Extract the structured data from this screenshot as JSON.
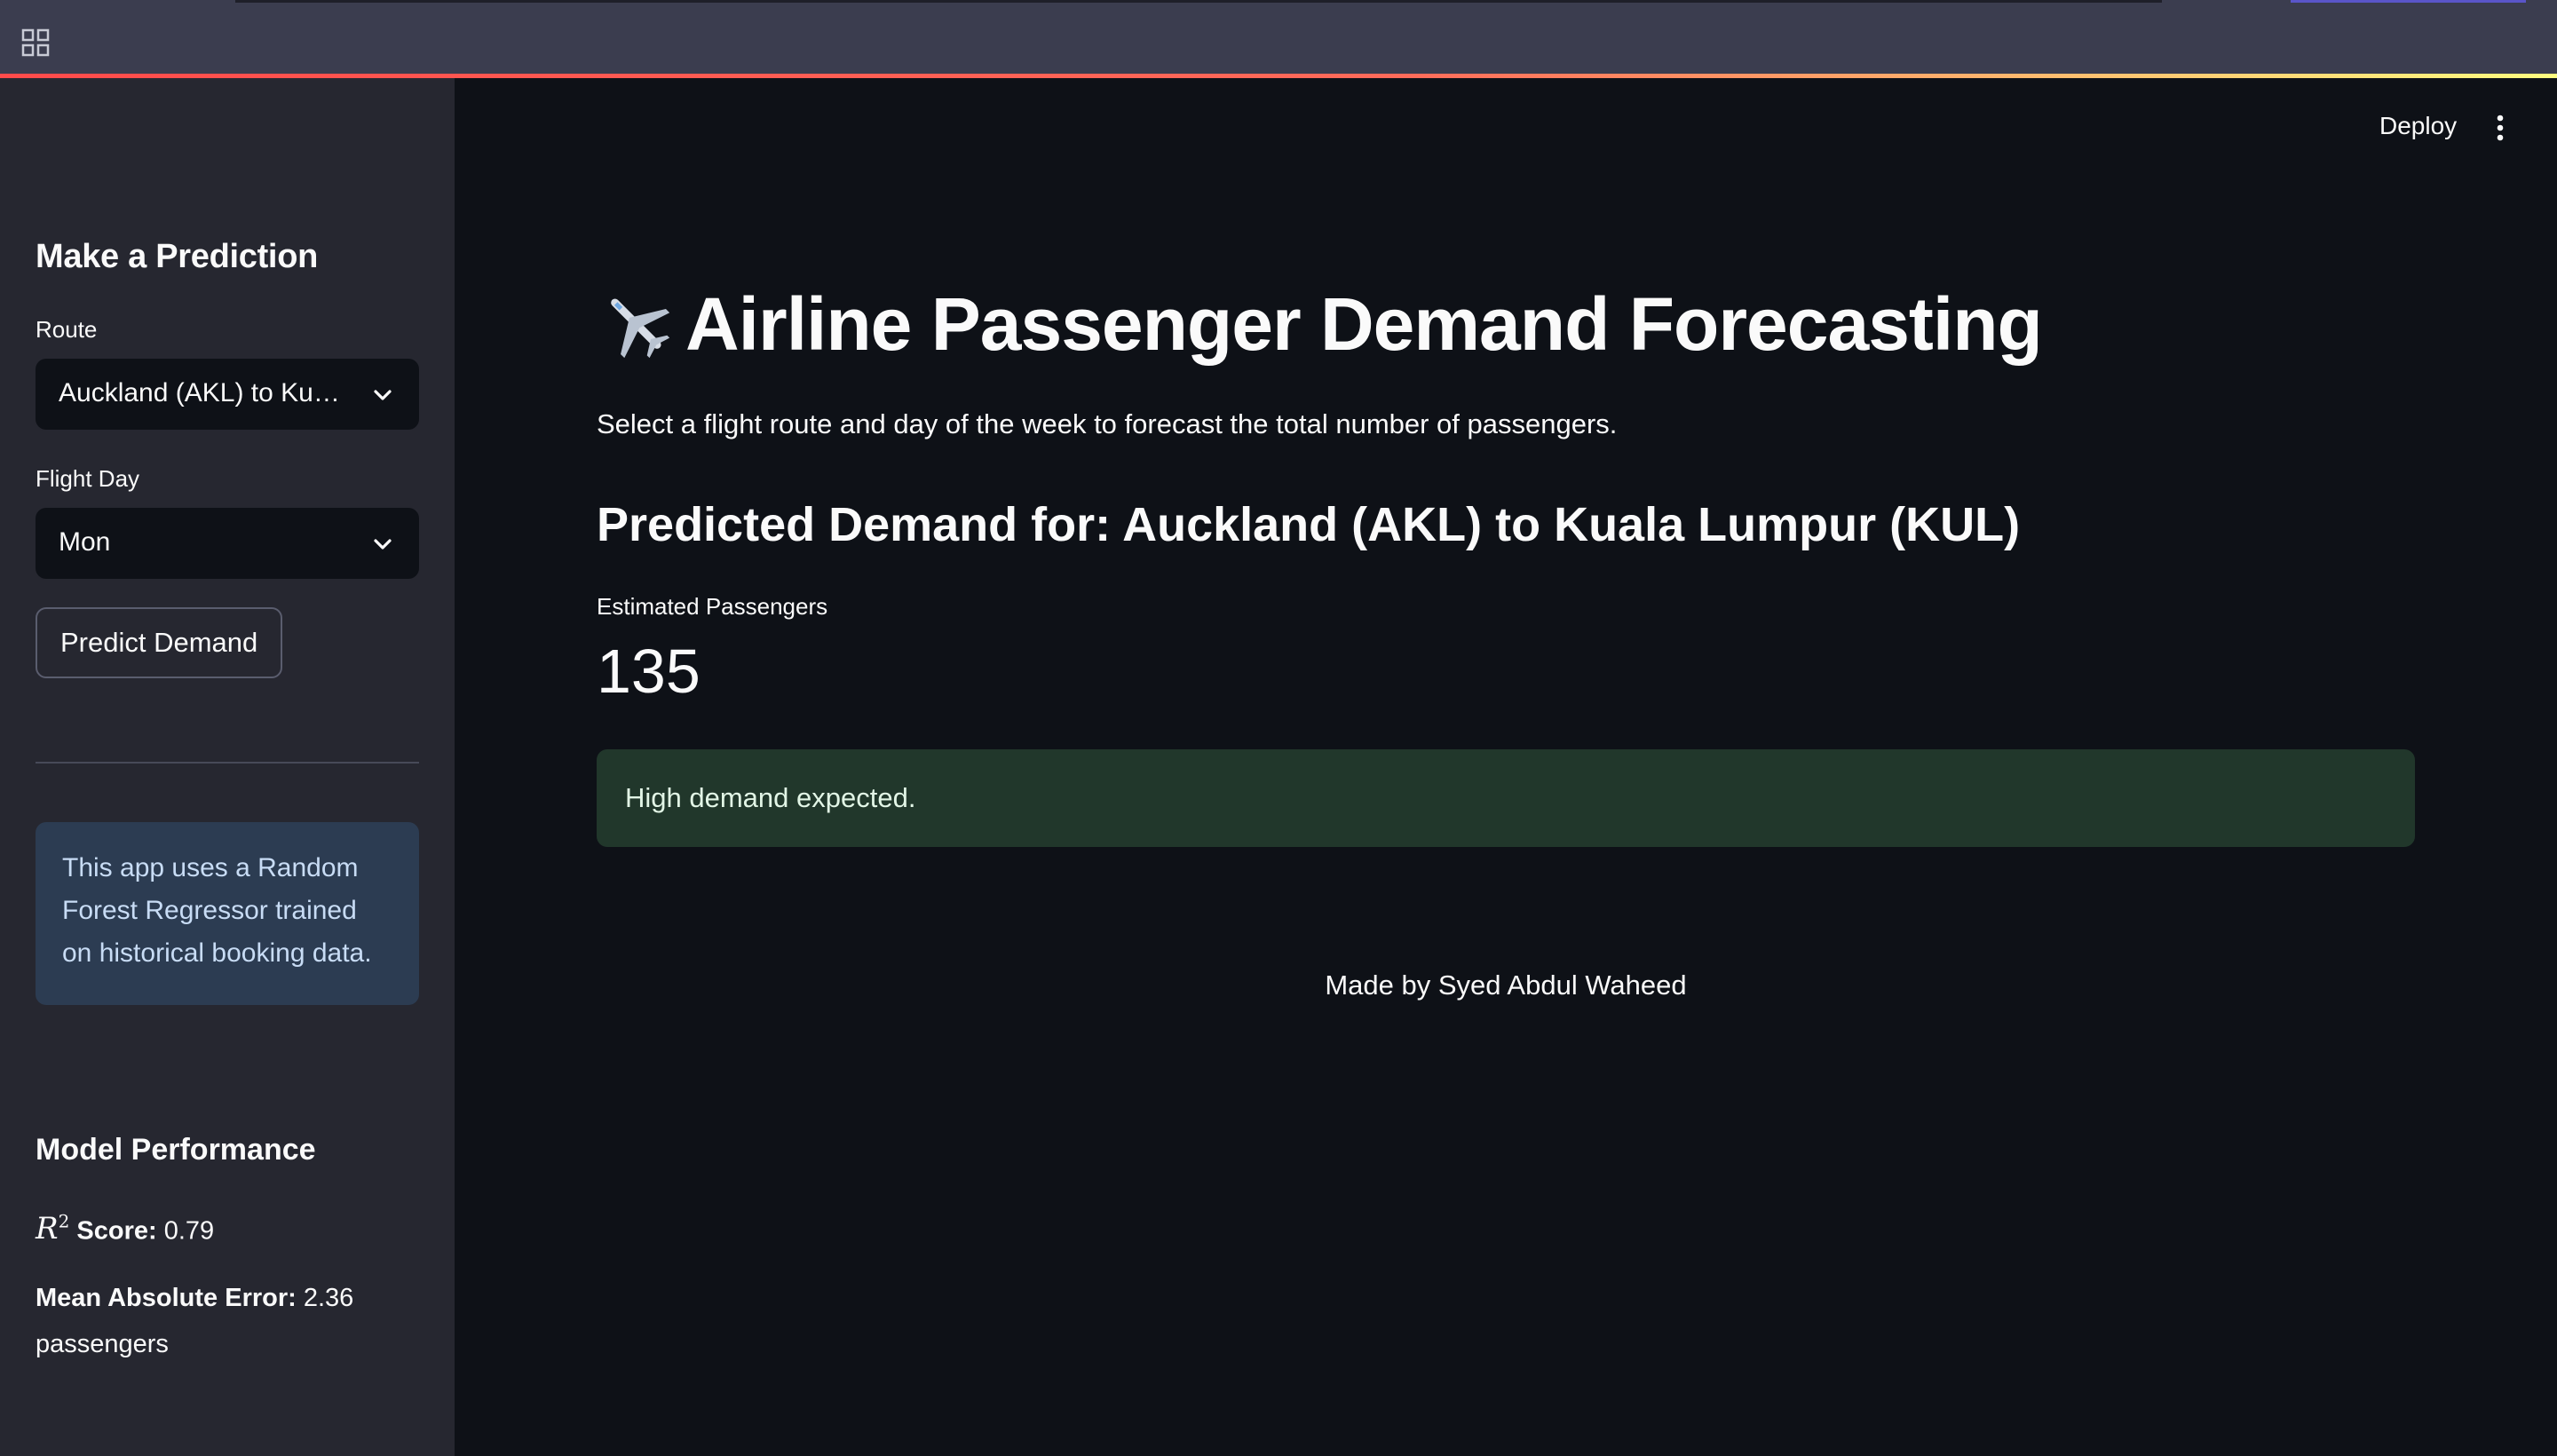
{
  "theme": {
    "accent": "#ff4b4b",
    "background": "#0e1117",
    "sidebar_background": "#262730",
    "success_background": "#21372b",
    "info_background": "#2c3c52"
  },
  "toolbar": {
    "deploy_label": "Deploy",
    "menu_icon": "kebab-menu-icon",
    "grid_icon": "grid-icon"
  },
  "sidebar": {
    "heading": "Make a Prediction",
    "route": {
      "label": "Route",
      "selected": "Auckland (AKL) to Ku…"
    },
    "flight_day": {
      "label": "Flight Day",
      "selected": "Mon"
    },
    "predict_button": "Predict Demand",
    "info_text": "This app uses a Random Forest Regressor trained on historical booking data.",
    "model_performance": {
      "heading": "Model Performance",
      "r2_symbol": "R",
      "r2_superscript": "2",
      "r2_label": "Score:",
      "r2_value": "0.79",
      "mae_label": "Mean Absolute Error:",
      "mae_value": "2.36 passengers"
    }
  },
  "main": {
    "title_icon": "airplane-icon",
    "title": "Airline Passenger Demand Forecasting",
    "subtitle": "Select a flight route and day of the week to forecast the total number of passengers.",
    "prediction_heading": "Predicted Demand for: Auckland (AKL) to Kuala Lumpur (KUL)",
    "metric": {
      "label": "Estimated Passengers",
      "value": "135"
    },
    "status_message": "High demand expected.",
    "footer": "Made by Syed Abdul Waheed"
  }
}
